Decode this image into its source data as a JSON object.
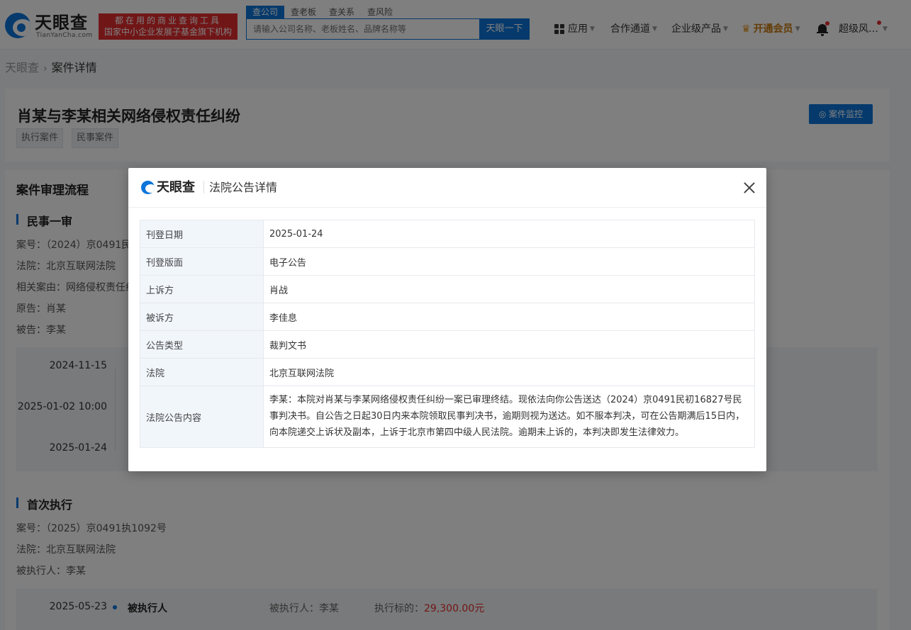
{
  "header": {
    "logo_name": "天眼查",
    "logo_sub": "TianYanCha.com",
    "slogan_line1": "都在用的商业查询工具",
    "slogan_line2": "国家中小企业发展子基金旗下机构",
    "search_tabs": [
      "查公司",
      "查老板",
      "查关系",
      "查风险"
    ],
    "search_placeholder": "请输入公司名称、老板姓名、品牌名称等",
    "search_button": "天眼一下",
    "nav_apps": "应用",
    "nav_coop": "合作通道",
    "nav_enterprise": "企业级产品",
    "nav_vip": "开通会员",
    "user_name": "超级风…"
  },
  "breadcrumb": {
    "home": "天眼查",
    "current": "案件详情"
  },
  "case": {
    "title": "肖某与李某相关网络侵权责任纠纷",
    "tags": [
      "执行案件",
      "民事案件"
    ],
    "monitor_button": "案件监控"
  },
  "process": {
    "heading": "案件审理流程",
    "first_trial": {
      "heading": "民事一审",
      "case_no": "案号：（2024）京0491民",
      "court": "法院：北京互联网法院",
      "cause": "相关案由：网络侵权责任纠",
      "plaintiff": "原告：肖某",
      "defendant": "被告：李某",
      "dates": [
        "2024-11-15",
        "2025-01-02 10:00",
        "2025-01-24"
      ]
    },
    "first_execution": {
      "heading": "首次执行",
      "case_no": "案号：（2025）京0491执1092号",
      "court": "法院：北京互联网法院",
      "executed": "被执行人：李某",
      "row_date": "2025-05-23",
      "row_type": "被执行人",
      "row_person": "被执行人：李某",
      "row_amount_label": "执行标的：",
      "row_amount": "29,300.00元"
    }
  },
  "modal": {
    "logo": "天眼查",
    "title": "法院公告详情",
    "rows": [
      {
        "key": "刊登日期",
        "value": "2025-01-24"
      },
      {
        "key": "刊登版面",
        "value": "电子公告"
      },
      {
        "key": "上诉方",
        "value": "肖战"
      },
      {
        "key": "被诉方",
        "value": "李佳息"
      },
      {
        "key": "公告类型",
        "value": "裁判文书"
      },
      {
        "key": "法院",
        "value": "北京互联网法院"
      },
      {
        "key": "法院公告内容",
        "value": "李某：本院对肖某与李某网络侵权责任纠纷一案已审理终结。现依法向你公告送达（2024）京0491民初16827号民事判决书。自公告之日起30日内来本院领取民事判决书，逾期则视为送达。如不服本判决，可在公告期满后15日内，向本院递交上诉状及副本，上诉于北京市第四中级人民法院。逾期未上诉的，本判决即发生法律效力。"
      }
    ]
  },
  "colors": {
    "brand_blue": "#0d75d9",
    "slogan_red": "#e22d2e",
    "amount_red": "#e22d2e",
    "vip_gold": "#c8780a"
  }
}
